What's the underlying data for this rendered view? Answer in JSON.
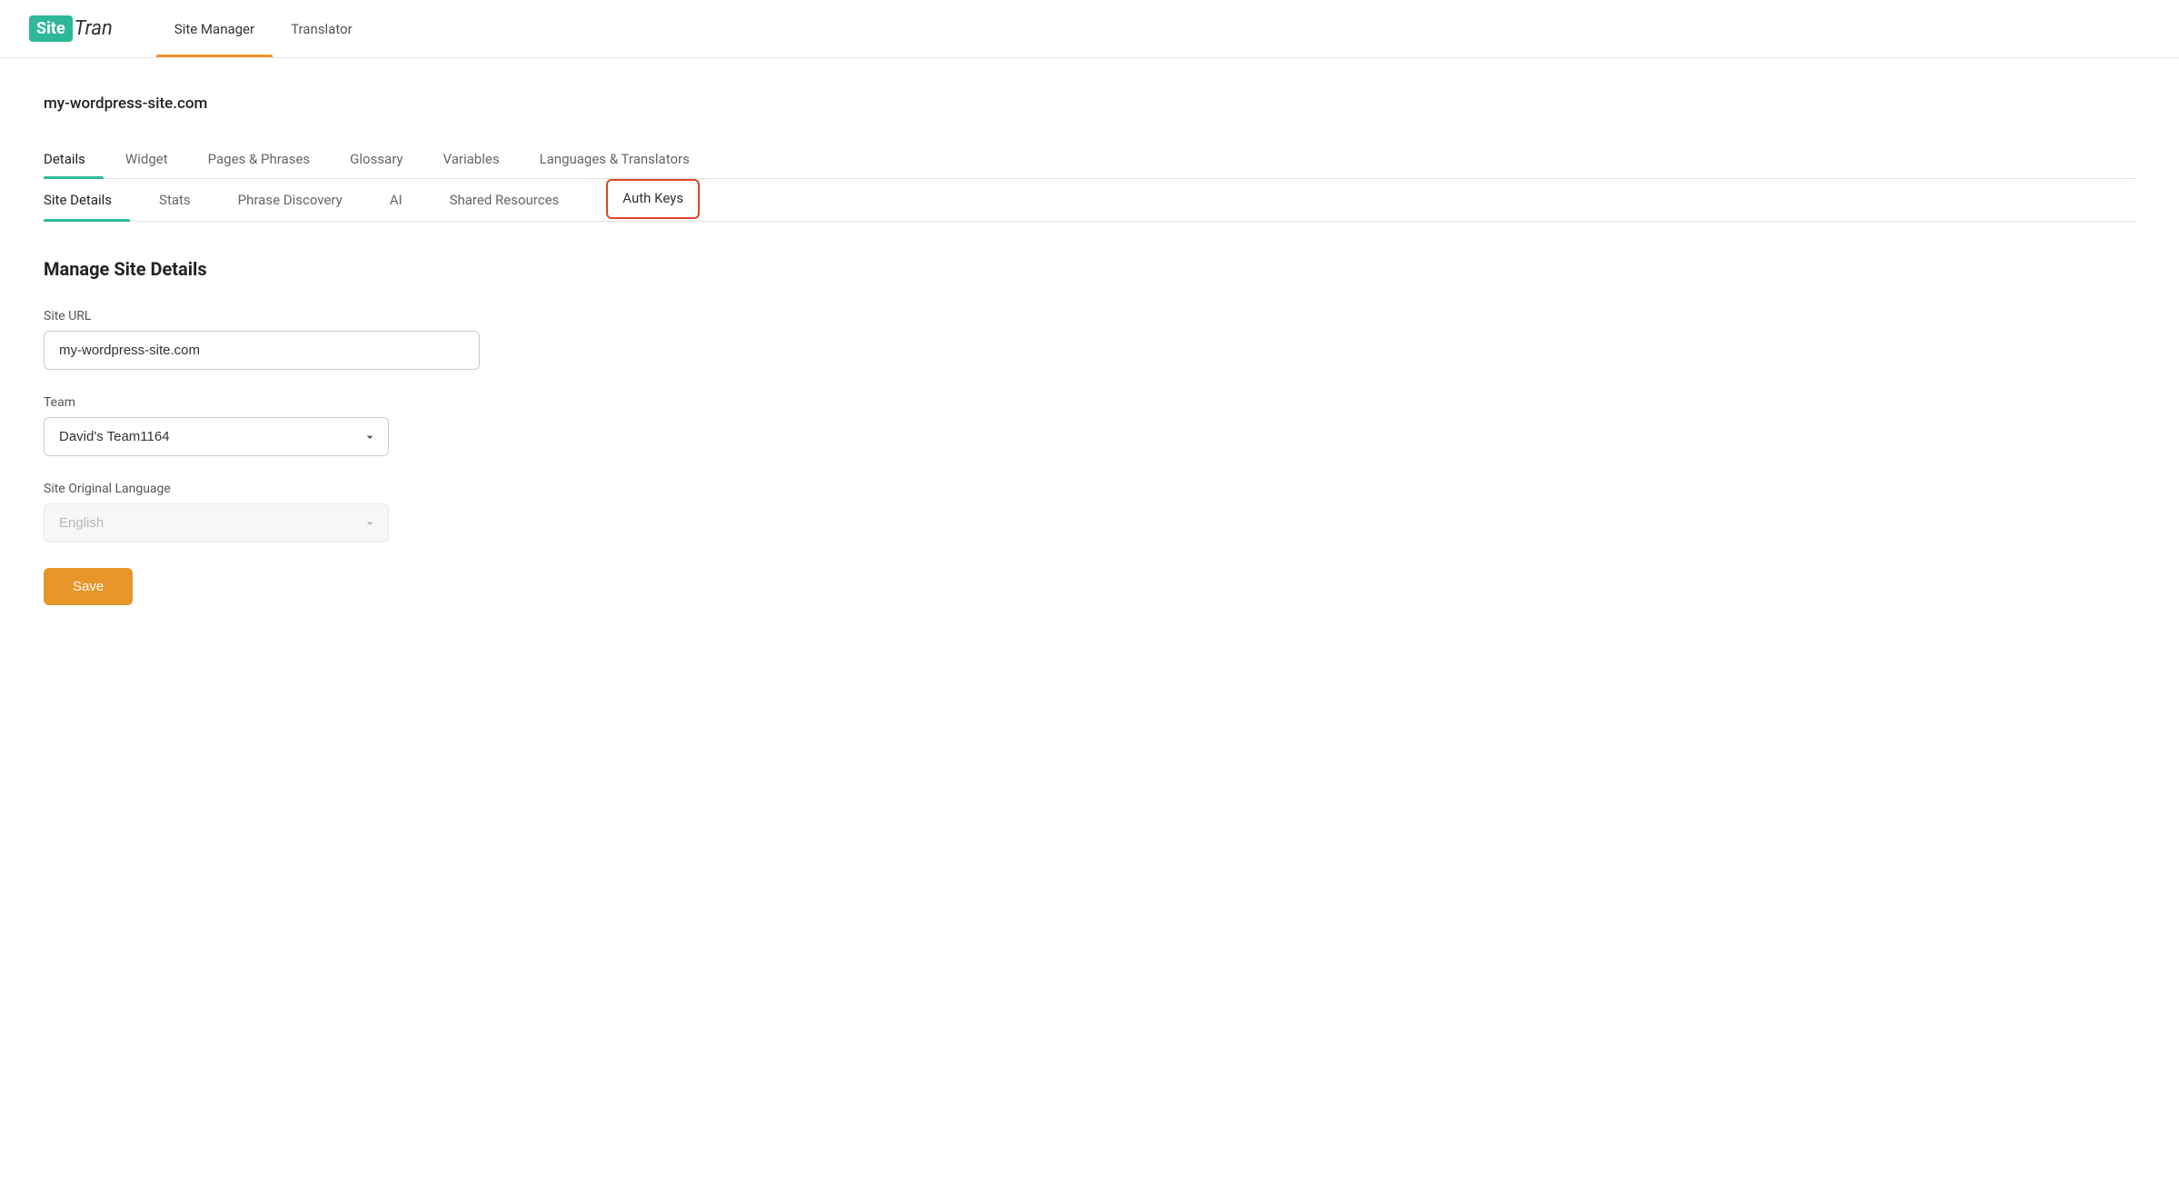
{
  "logo": {
    "site_part": "Site",
    "tran_part": "Tran"
  },
  "top_nav": {
    "links": [
      {
        "id": "site-manager",
        "label": "Site Manager",
        "active": true
      },
      {
        "id": "translator",
        "label": "Translator",
        "active": false
      }
    ]
  },
  "site_name": "my-wordpress-site.com",
  "main_tabs": [
    {
      "id": "details",
      "label": "Details",
      "active": true
    },
    {
      "id": "widget",
      "label": "Widget",
      "active": false
    },
    {
      "id": "pages-phrases",
      "label": "Pages & Phrases",
      "active": false
    },
    {
      "id": "glossary",
      "label": "Glossary",
      "active": false
    },
    {
      "id": "variables",
      "label": "Variables",
      "active": false
    },
    {
      "id": "languages-translators",
      "label": "Languages & Translators",
      "active": false
    }
  ],
  "sub_tabs": [
    {
      "id": "site-details",
      "label": "Site Details",
      "active": true,
      "highlighted": false
    },
    {
      "id": "stats",
      "label": "Stats",
      "active": false,
      "highlighted": false
    },
    {
      "id": "phrase-discovery",
      "label": "Phrase Discovery",
      "active": false,
      "highlighted": false
    },
    {
      "id": "ai",
      "label": "AI",
      "active": false,
      "highlighted": false
    },
    {
      "id": "shared-resources",
      "label": "Shared Resources",
      "active": false,
      "highlighted": false
    },
    {
      "id": "auth-keys",
      "label": "Auth Keys",
      "active": false,
      "highlighted": true
    }
  ],
  "form": {
    "section_title": "Manage Site Details",
    "site_url_label": "Site URL",
    "site_url_value": "my-wordpress-site.com",
    "team_label": "Team",
    "team_value": "David's Team1164",
    "team_options": [
      {
        "value": "david-team-1164",
        "label": "David's Team1164"
      }
    ],
    "site_original_language_label": "Site Original Language",
    "site_original_language_value": "English",
    "site_original_language_placeholder": "English",
    "save_button_label": "Save"
  }
}
